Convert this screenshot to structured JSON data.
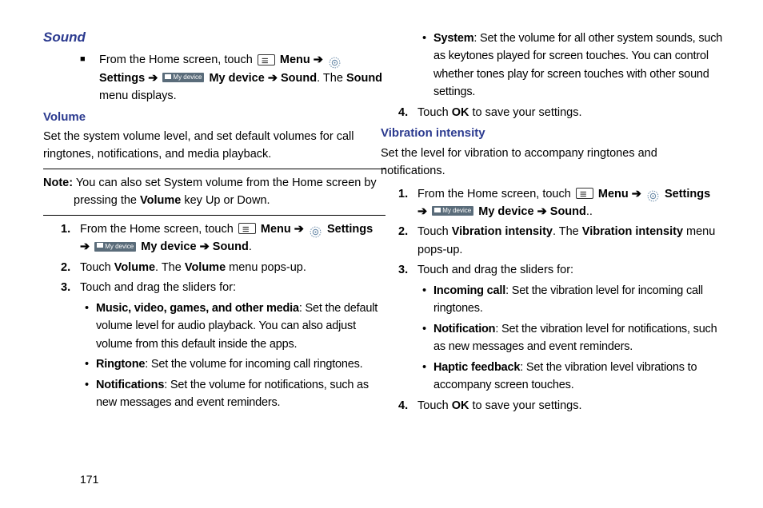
{
  "page_number": "171",
  "left": {
    "h1": "Sound",
    "intro": {
      "from_home": "From the Home screen, touch ",
      "menu": "Menu",
      "settings": "Settings",
      "mydevice": "My device",
      "sound": "Sound",
      "tail": ". The ",
      "sound2": "Sound",
      "tail2": " menu displays."
    },
    "h2_volume": "Volume",
    "volume_para": "Set the system volume level, and set default volumes for call ringtones, notifications, and media playback.",
    "note_label": "Note:",
    "note_a": " You can also set System volume from the Home screen by pressing the ",
    "note_b": "Volume",
    "note_c": " key Up or Down.",
    "step1": {
      "from_home": "From the Home screen, touch ",
      "menu": "Menu",
      "settings": "Settings",
      "mydevice": "My device",
      "sound": "Sound",
      "end": "."
    },
    "step2_a": "Touch ",
    "step2_b": "Volume",
    "step2_c": ". The ",
    "step2_d": "Volume",
    "step2_e": " menu pops-up.",
    "step3": "Touch and drag the sliders for:",
    "b1_t": "Music, video, games, and other media",
    "b1_r": ": Set the default volume level for audio playback. You can also adjust volume from this default inside the apps.",
    "b2_t": "Ringtone",
    "b2_r": ": Set the volume for incoming call ringtones.",
    "b3_t": "Notifications",
    "b3_r": ": Set the volume for notifications, such as new messages and event reminders."
  },
  "right": {
    "b4_t": "System",
    "b4_r": ": Set the volume for all other system sounds, such as keytones played for screen touches. You can control whether tones play for screen touches with other sound settings.",
    "step4_a": "Touch ",
    "step4_b": "OK",
    "step4_c": " to save your settings.",
    "h2_vib": "Vibration intensity",
    "vib_para": "Set the level for vibration to accompany ringtones and notifications.",
    "vstep1": {
      "from_home": "From the Home screen, touch ",
      "menu": "Menu",
      "settings": "Settings",
      "mydevice": "My device",
      "sound": "Sound",
      "end": ".."
    },
    "vstep2_a": "Touch ",
    "vstep2_b": "Vibration intensity",
    "vstep2_c": ". The ",
    "vstep2_d": "Vibration intensity",
    "vstep2_e": " menu pops-up.",
    "vstep3": "Touch and drag the sliders for:",
    "vb1_t": "Incoming call",
    "vb1_r": ": Set the vibration level for incoming call ringtones.",
    "vb2_t": "Notification",
    "vb2_r": ": Set the vibration level for notifications, such as new messages and event reminders.",
    "vb3_t": "Haptic feedback",
    "vb3_r": ": Set the vibration level vibrations to accompany screen touches.",
    "vstep4_a": "Touch ",
    "vstep4_b": "OK",
    "vstep4_c": " to save your settings."
  },
  "num1": "1.",
  "num2": "2.",
  "num3": "3.",
  "num4": "4.",
  "arrow": "➔",
  "mydevice_label": "My device"
}
